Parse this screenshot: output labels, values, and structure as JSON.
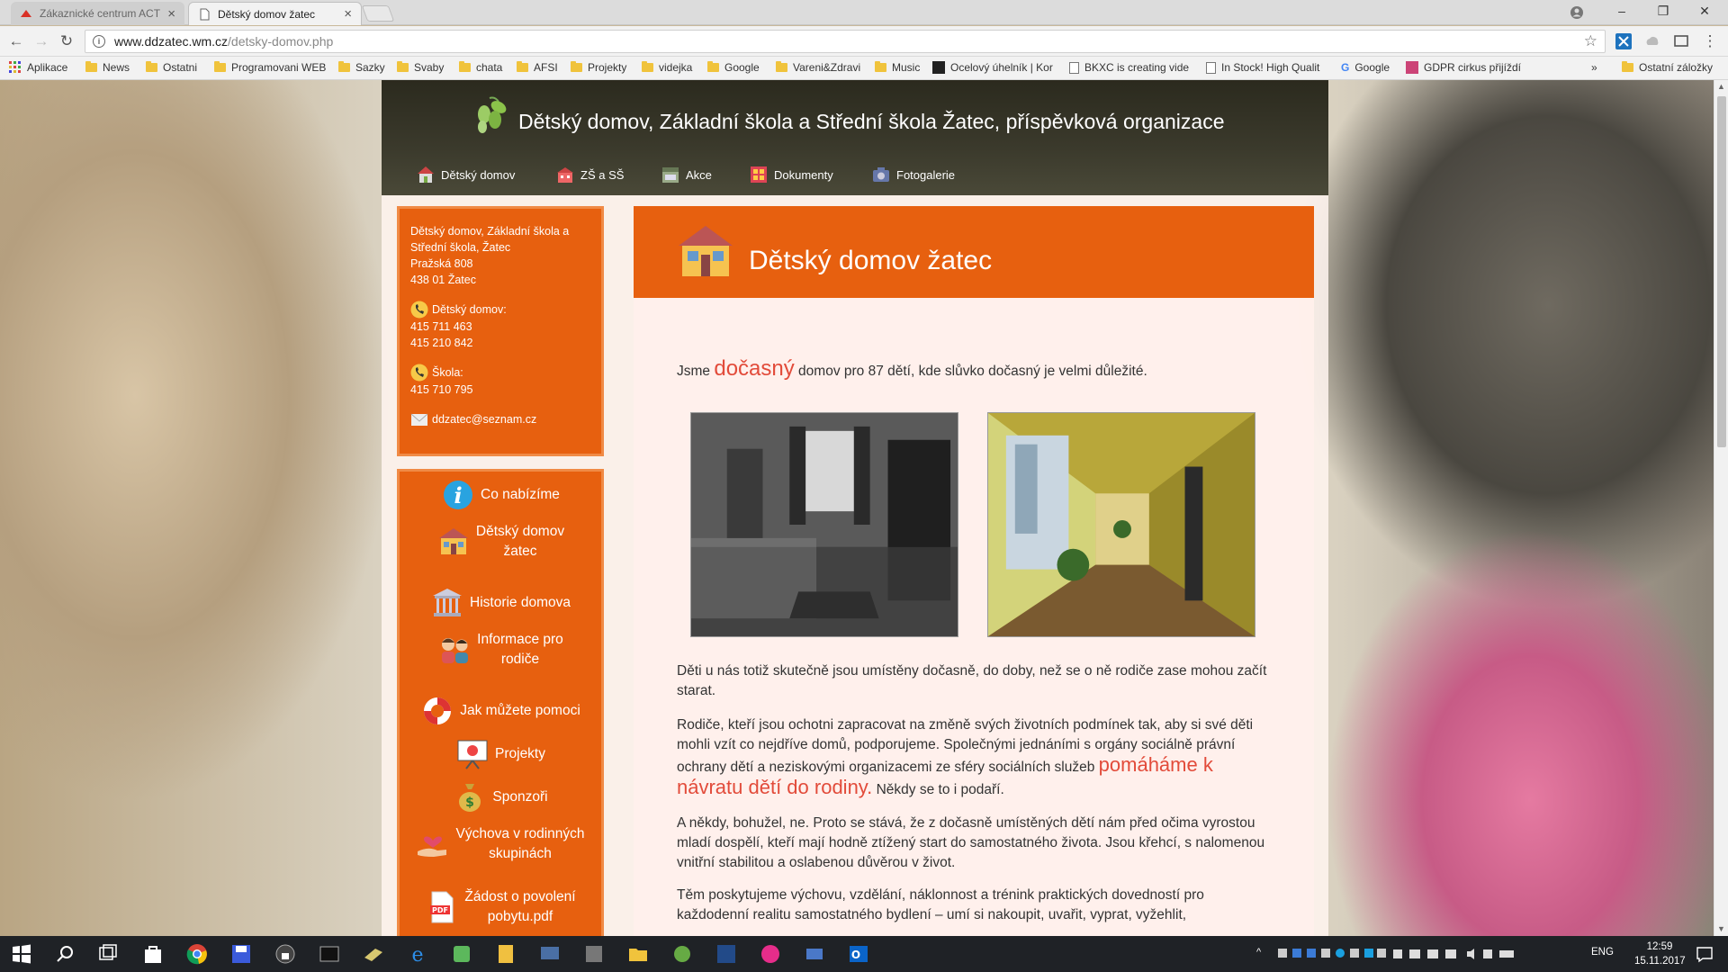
{
  "browser": {
    "tabs": [
      {
        "label": "Zákaznické centrum ACT",
        "active": false
      },
      {
        "label": "Dětský domov žatec",
        "active": true
      }
    ],
    "url_domain": "www.ddzatec.wm.cz",
    "url_path": "/detsky-domov.php"
  },
  "bookmarks": [
    "Aplikace",
    "News",
    "Ostatni",
    "Programovani WEB",
    "Sazky",
    "Svaby",
    "chata",
    "AFSI",
    "Projekty",
    "videjka",
    "Google",
    "Vareni&Zdravi",
    "Music",
    "Ocelový úhelník | Kor",
    "BKXC is creating vide",
    "In Stock! High Qualit",
    "Google",
    "GDPR cirkus přijíždí",
    "»",
    "Ostatní záložky"
  ],
  "site": {
    "title": "Dětský domov, Základní škola a Střední škola Žatec, příspěvková organizace",
    "nav": [
      "Dětský domov",
      "ZŠ a SŠ",
      "Akce",
      "Dokumenty",
      "Fotogalerie"
    ]
  },
  "contact": {
    "address": [
      "Dětský domov, Základní škola a",
      "Střední škola, Žatec",
      "Pražská 808",
      "438 01 Žatec"
    ],
    "home_label": "Dětský domov:",
    "home_phones": [
      "415 711 463",
      "415 210 842"
    ],
    "school_label": "Škola:",
    "school_phone": "415 710 795",
    "email": "ddzatec@seznam.cz"
  },
  "sidebar_nav": [
    {
      "lines": [
        "Co nabízíme"
      ],
      "icon": "info-icon"
    },
    {
      "lines": [
        "Dětský domov",
        "žatec"
      ],
      "icon": "house-icon"
    },
    {
      "lines": [
        "Historie domova"
      ],
      "icon": "building-icon"
    },
    {
      "lines": [
        "Informace pro",
        "rodiče"
      ],
      "icon": "parents-icon"
    },
    {
      "lines": [
        "Jak můžete pomoci"
      ],
      "icon": "lifebuoy-icon"
    },
    {
      "lines": [
        "Projekty"
      ],
      "icon": "presentation-icon"
    },
    {
      "lines": [
        "Sponzoři"
      ],
      "icon": "money-bag-icon"
    },
    {
      "lines": [
        "Výchova v rodinných",
        "skupinách"
      ],
      "icon": "heart-hand-icon"
    },
    {
      "lines": [
        "Žádost o povolení",
        "pobytu.pdf"
      ],
      "icon": "pdf-icon"
    }
  ],
  "content": {
    "title": "Dětský domov žatec",
    "intro_before": "Jsme ",
    "intro_accent": "dočasný",
    "intro_after": " domov pro 87 dětí, kde slůvko dočasný je velmi důležité.",
    "p1": "Děti u nás totiž skutečně jsou umístěny dočasně, do doby, než se o ně rodiče zase mohou začít starat.",
    "p2_before": "Rodiče, kteří jsou ochotni zapracovat na změně svých životních podmínek tak, aby si své děti mohli vzít co nejdříve domů, podporujeme. Společnými jednáními s orgány sociálně právní ochrany dětí a neziskovými organizacemi ze sféry sociálních služeb ",
    "p2_accent": "pomáháme k návratu dětí do rodiny.",
    "p2_after": " Někdy se to i podaří.",
    "p3": "A někdy, bohužel, ne. Proto se stává, že z dočasně umístěných dětí nám před očima vyrostou mladí dospělí, kteří mají hodně ztížený start do samostatného života. Jsou křehcí, s nalomenou vnitřní stabilitou a oslabenou důvěrou v život.",
    "p4": "Těm poskytujeme výchovu, vzdělání, náklonnost a trénink praktických dovedností pro každodenní realitu samostatného bydlení – umí si nakoupit, uvařit, vyprat, vyžehlit,"
  },
  "taskbar": {
    "lang": "ENG",
    "time": "12:59",
    "date": "15.11.2017"
  },
  "colors": {
    "accent_orange": "#e7600f",
    "header_dark": "#2b2a1e",
    "text_accent": "#e24b3a"
  }
}
